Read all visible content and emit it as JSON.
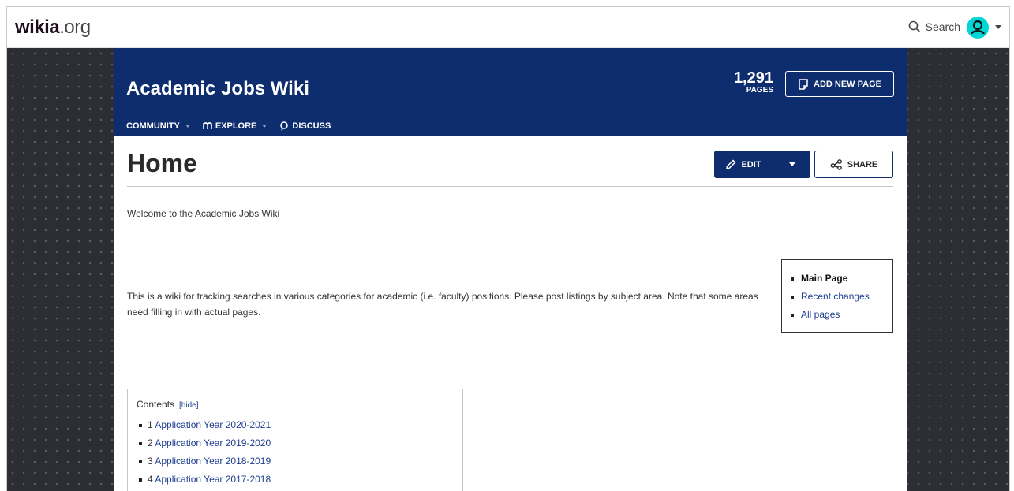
{
  "topbar": {
    "logo_bold": "wikia",
    "logo_light": ".org",
    "search_label": "Search"
  },
  "header": {
    "wiki_title": "Academic Jobs Wiki",
    "page_count": "1,291",
    "page_count_label": "PAGES",
    "add_page_label": "ADD NEW PAGE",
    "nav": [
      {
        "label": "COMMUNITY"
      },
      {
        "label": "EXPLORE"
      },
      {
        "label": "DISCUSS"
      }
    ]
  },
  "article": {
    "title": "Home",
    "edit_label": "EDIT",
    "share_label": "SHARE",
    "welcome": "Welcome to the Academic Jobs Wiki",
    "intro": "This is a wiki for tracking searches in various categories for academic (i.e. faculty) positions. Please post listings by subject area. Note that some areas need filling in with actual pages."
  },
  "sidebox": {
    "items": [
      {
        "label": "Main Page"
      },
      {
        "label": "Recent changes"
      },
      {
        "label": "All pages"
      }
    ]
  },
  "toc": {
    "title": "Contents",
    "hide_label": "[hide]",
    "items": [
      {
        "num": "1",
        "label": "Application Year 2020-2021"
      },
      {
        "num": "2",
        "label": "Application Year 2019-2020"
      },
      {
        "num": "3",
        "label": "Application Year 2018-2019"
      },
      {
        "num": "4",
        "label": "Application Year 2017-2018"
      }
    ]
  },
  "colors": {
    "header_bg": "#0d2d6e",
    "link": "#1e3e90",
    "background": "#2c2e33",
    "avatar": "#00d6d6"
  }
}
